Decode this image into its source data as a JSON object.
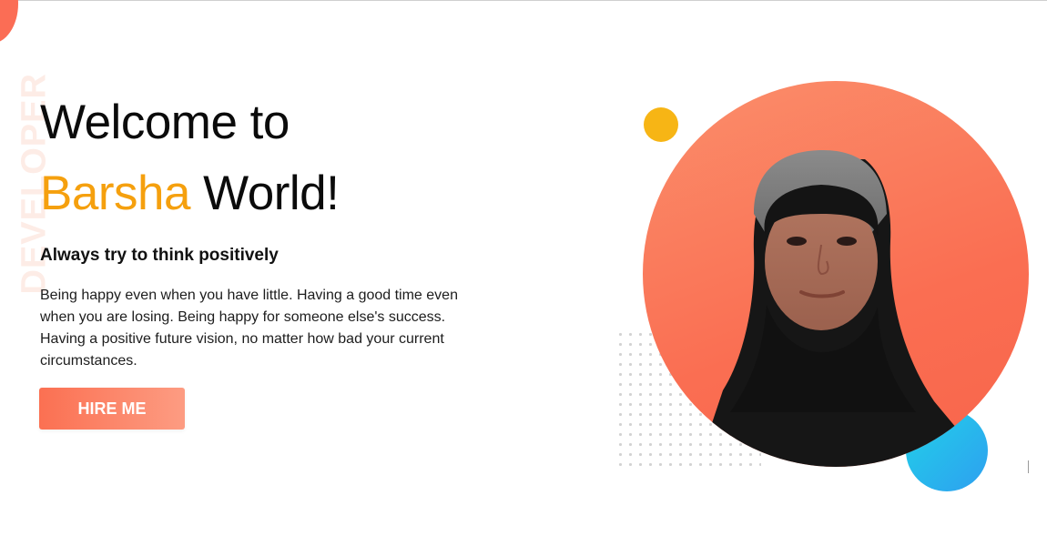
{
  "hero": {
    "vertical_word": "DEVELOPER",
    "headline_line1": "Welcome to",
    "headline_name": "Barsha",
    "headline_rest": "World!",
    "tagline": "Always try to think positively",
    "description": "Being happy even when you have little. Having a good time even when you are losing. Being happy for someone else's success. Having a positive future vision, no matter how bad your current circumstances.",
    "cta_label": "HIRE ME"
  },
  "colors": {
    "accent": "#f5a00e",
    "button_start": "#fb7052",
    "button_end": "#fd9c82",
    "circle_main": "#fa6e52",
    "yellow_dot": "#f7b515",
    "blue_circle": "#2e9ff0"
  }
}
